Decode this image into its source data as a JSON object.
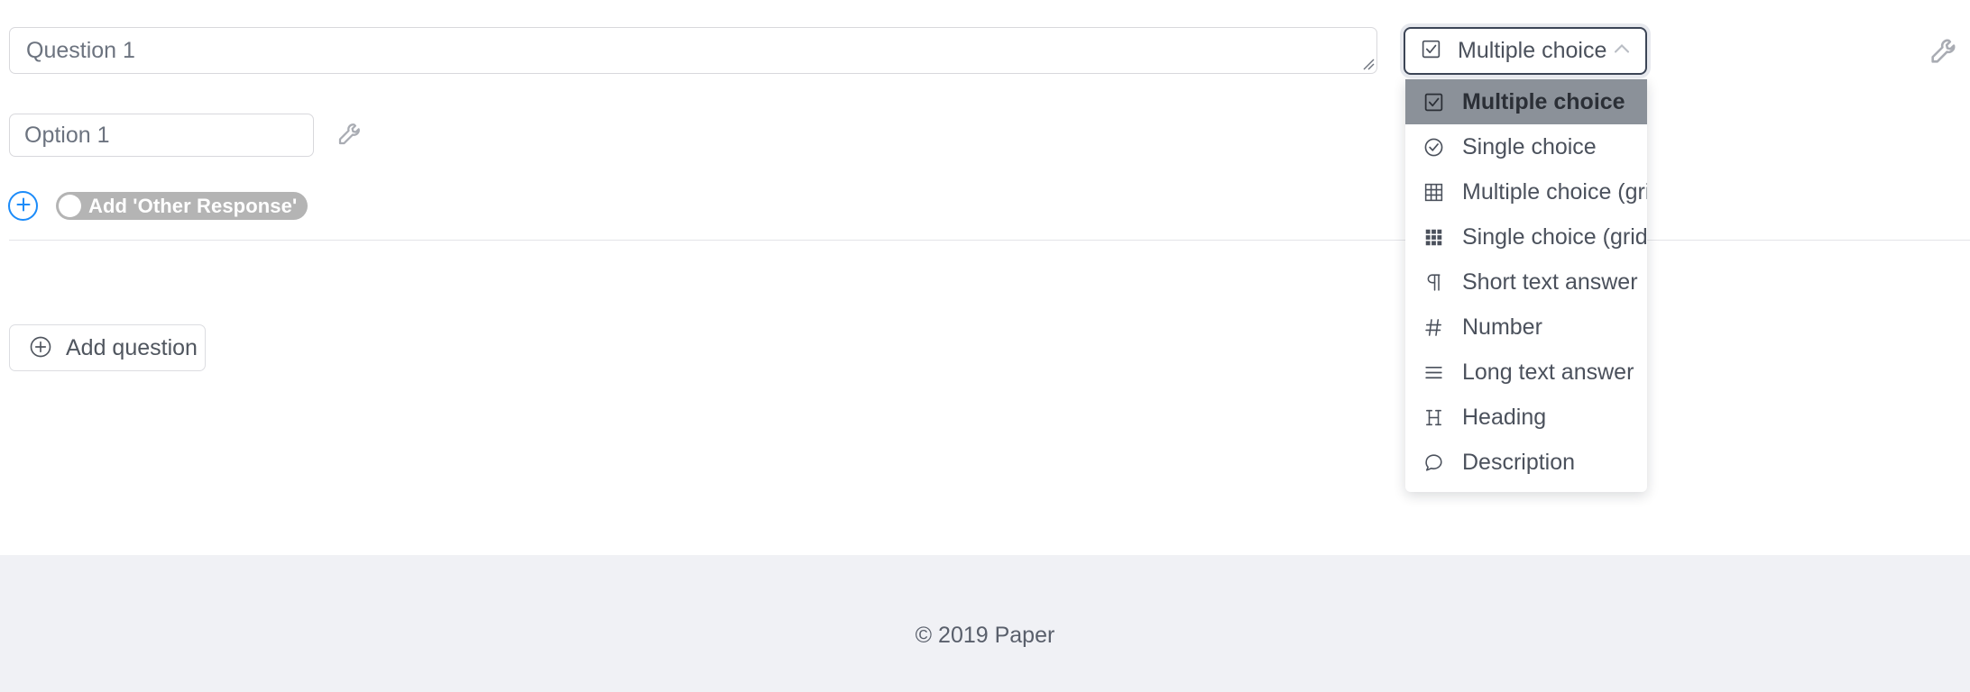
{
  "question": {
    "placeholder": "Question 1",
    "value": ""
  },
  "option": {
    "placeholder": "Option 1",
    "value": "",
    "settings_icon": "wrench-icon"
  },
  "other_response": {
    "add_icon": "plus-circle-icon",
    "toggle_label": "Add 'Other Response'",
    "toggle_on": false
  },
  "add_question": {
    "label": "Add question",
    "icon": "plus-circle-icon"
  },
  "question_type_select": {
    "selected_label": "Multiple choice",
    "selected_icon": "checkbox-checked-icon",
    "chevron": "chevron-up-icon",
    "expanded": true
  },
  "dropdown": {
    "items": [
      {
        "label": "Multiple choice",
        "icon": "checkbox-checked-icon",
        "selected": true
      },
      {
        "label": "Single choice",
        "icon": "radio-checked-icon",
        "selected": false
      },
      {
        "label": "Multiple choice (grid)",
        "icon": "grid-outline-icon",
        "selected": false
      },
      {
        "label": "Single choice (grid)",
        "icon": "grid-dots-icon",
        "selected": false
      },
      {
        "label": "Short text answer",
        "icon": "pilcrow-icon",
        "selected": false
      },
      {
        "label": "Number",
        "icon": "hash-icon",
        "selected": false
      },
      {
        "label": "Long text answer",
        "icon": "lines-icon",
        "selected": false
      },
      {
        "label": "Heading",
        "icon": "heading-h-icon",
        "selected": false
      },
      {
        "label": "Description",
        "icon": "speech-bubble-icon",
        "selected": false
      }
    ]
  },
  "top_settings": {
    "icon": "wrench-icon"
  },
  "footer": {
    "copyright": "© 2019 Paper"
  },
  "colors": {
    "accent_blue": "#1b8bf9",
    "toggle_off": "#b4b4b4",
    "selected_row": "#8b9199",
    "footer_bg": "#f0f1f5",
    "border": "#d8d8dc",
    "select_border": "#3c4556",
    "text": "#4b515c"
  }
}
